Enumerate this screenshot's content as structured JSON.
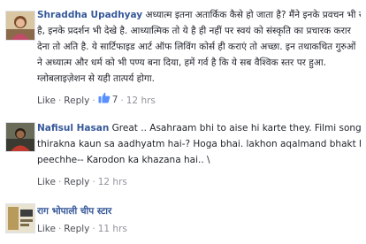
{
  "comments": [
    {
      "author": "Shraddha Upadhyay",
      "lines": [
        "अध्यात्म इतना अतार्किक कैसे हो जाता है? मैंने इनके प्रवचन भी सुने",
        "है, इनके प्रदर्शन भी देखे है. आध्यात्मिक तो ये है ही नहीं पर स्वयं को संस्कृति का प्रचारक करार",
        "देना तो अति है. ये सार्टिफाइड आर्ट ऑफ लिविंग कोर्स ही कराएं तो अच्छा. इन तथाकथित गुरुओं",
        "ने अध्यात्म और धर्म को भी पण्य बना दिया, हमें गर्व है कि ये सब वैश्विक स्तर पर हुआ.",
        "ग्लोबलाइज़ेशन से यही तात्पर्य होगा."
      ],
      "like": "Like",
      "reply": "Reply",
      "likes": "7",
      "time": "12 hrs"
    },
    {
      "author": "Nafisul Hasan",
      "lines": [
        "Great .. Asahraam bhi to aise hi karte they. Filmi song par",
        "thirakna kaun sa aadhyatm hai-? Hoga bhai. lakhon aqalmand bhakt hain inke",
        "peechhe-- Karodon ka khazana hai.. \\"
      ],
      "like": "Like",
      "reply": "Reply",
      "time": "12 hrs"
    },
    {
      "author": "राग भोपाली चीप स्टार",
      "lines": [],
      "like": "Like",
      "reply": "Reply",
      "time": "11 hrs"
    }
  ],
  "colors": {
    "author": "#365899",
    "meta": "#90949c",
    "like_icon": "#5890ff"
  }
}
